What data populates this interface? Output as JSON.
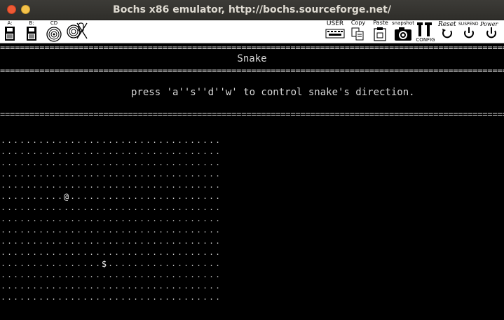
{
  "window": {
    "title": "Bochs x86 emulator, http://bochs.sourceforge.net/"
  },
  "toolbar": {
    "floppy_a": "A:",
    "floppy_b": "B:",
    "cdrom": "CD",
    "user": "USER",
    "copy": "Copy",
    "paste": "Paste",
    "snapshot": "snapshot",
    "config": "CONFIG",
    "reset": "Reset",
    "suspend": "SUSPEND",
    "power": "Power"
  },
  "console": {
    "heading": "Snake",
    "instructions": "press 'a''s''d''w' to control snake's direction.",
    "rule_char": "=",
    "grid": {
      "rows": 15,
      "cols": 35,
      "empty_char": ".",
      "snake_char": "@",
      "food_char": "$",
      "snake": {
        "row": 5,
        "col": 10
      },
      "food": {
        "row": 11,
        "col": 16
      }
    }
  },
  "colors": {
    "background": "#000000",
    "text": "#d8d8d8",
    "titlebar": "#3c3b37",
    "close_button": "#ef5a35",
    "minimize_button": "#f4c24a"
  }
}
